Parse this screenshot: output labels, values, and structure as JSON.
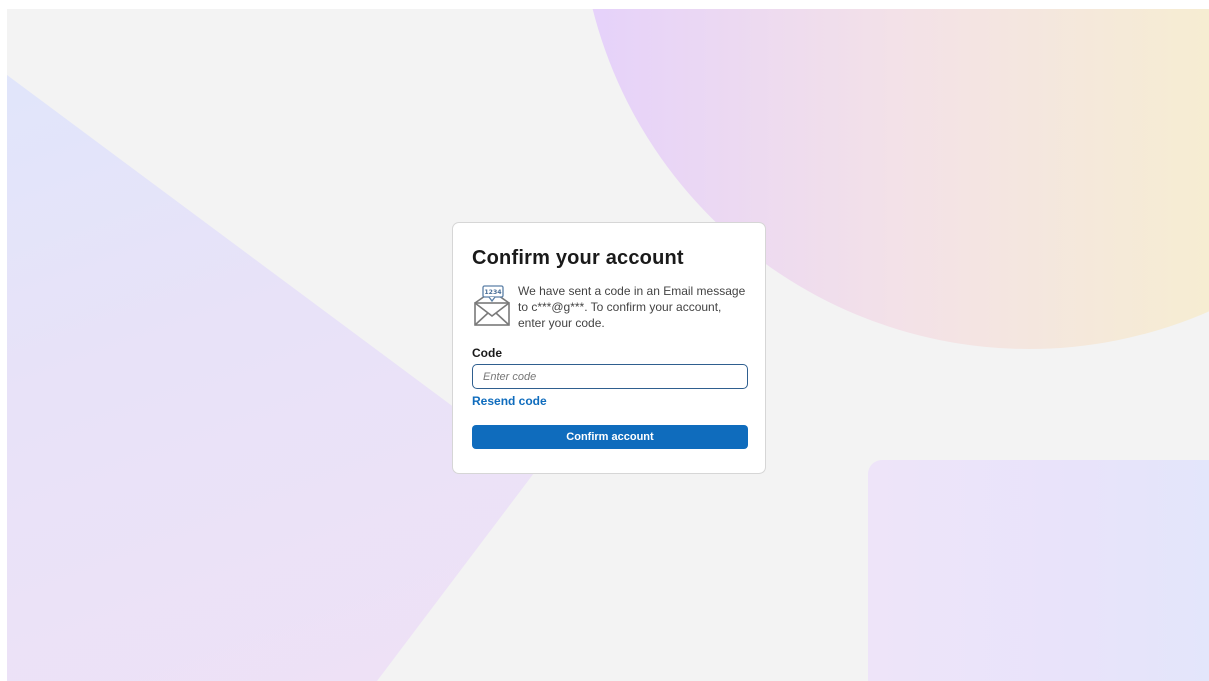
{
  "form": {
    "title": "Confirm your account",
    "info_text": "We have sent a code in an Email message to c***@g***. To confirm your account, enter your code.",
    "icon_code_text": "1234",
    "code_label": "Code",
    "code_placeholder": "Enter code",
    "code_value": "",
    "resend_label": "Resend code",
    "confirm_label": "Confirm account"
  },
  "icons": {
    "mail": "email-with-code-icon"
  },
  "colors": {
    "primary": "#0f6cbd",
    "input_border": "#2f5f8f",
    "page_background": "#f3f3f3",
    "card_background": "#ffffff"
  }
}
